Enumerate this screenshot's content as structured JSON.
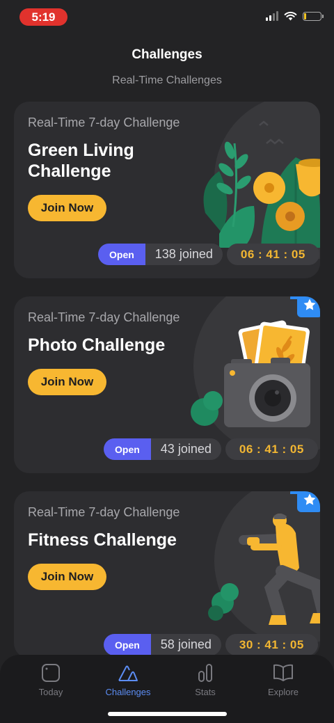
{
  "status_bar": {
    "time": "5:19"
  },
  "header": {
    "title": "Challenges",
    "subtitle": "Real-Time Challenges"
  },
  "cards": [
    {
      "kicker": "Real-Time 7-day Challenge",
      "title": "Green Living Challenge",
      "join_label": "Join Now",
      "status": "Open",
      "joined_count": "138",
      "joined_label": "joined",
      "timer": "06 : 41 : 05",
      "favorite": false,
      "illustration": "plants-flowers"
    },
    {
      "kicker": "Real-Time 7-day Challenge",
      "title": "Photo Challenge",
      "join_label": "Join Now",
      "status": "Open",
      "joined_count": "43",
      "joined_label": "joined",
      "timer": "06 : 41 : 05",
      "favorite": true,
      "illustration": "camera-photos"
    },
    {
      "kicker": "Real-Time 7-day Challenge",
      "title": "Fitness Challenge",
      "join_label": "Join Now",
      "status": "Open",
      "joined_count": "58",
      "joined_label": "joined",
      "timer": "30 : 41 : 05",
      "favorite": true,
      "illustration": "squatting-person"
    }
  ],
  "tab_bar": {
    "tabs": [
      {
        "label": "Today",
        "icon": "today-square-icon",
        "active": false
      },
      {
        "label": "Challenges",
        "icon": "challenges-mountain-icon",
        "active": true
      },
      {
        "label": "Stats",
        "icon": "stats-bars-icon",
        "active": false
      },
      {
        "label": "Explore",
        "icon": "book-icon",
        "active": false
      }
    ]
  },
  "colors": {
    "accent_yellow": "#f7b731",
    "open_badge": "#5a5ff0",
    "active_tab": "#5c8df3",
    "favorite_badge": "#2f8cf4"
  }
}
